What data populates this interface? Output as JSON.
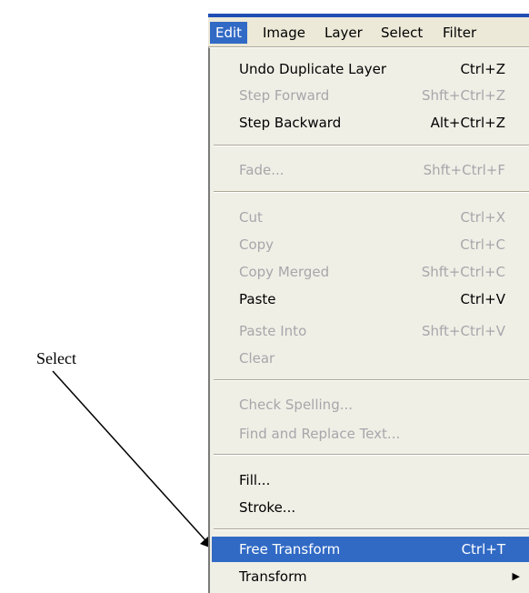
{
  "annotation": {
    "label": "Select"
  },
  "menubar": {
    "items": [
      {
        "label": "Edit",
        "active": true
      },
      {
        "label": "Image"
      },
      {
        "label": "Layer"
      },
      {
        "label": "Select"
      },
      {
        "label": "Filter"
      }
    ]
  },
  "menu": {
    "undo_duplicate_layer": {
      "label": "Undo Duplicate Layer",
      "shortcut": "Ctrl+Z"
    },
    "step_forward": {
      "label": "Step Forward",
      "shortcut": "Shft+Ctrl+Z"
    },
    "step_backward": {
      "label": "Step Backward",
      "shortcut": "Alt+Ctrl+Z"
    },
    "fade": {
      "label": "Fade...",
      "shortcut": "Shft+Ctrl+F"
    },
    "cut": {
      "label": "Cut",
      "shortcut": "Ctrl+X"
    },
    "copy": {
      "label": "Copy",
      "shortcut": "Ctrl+C"
    },
    "copy_merged": {
      "label": "Copy Merged",
      "shortcut": "Shft+Ctrl+C"
    },
    "paste": {
      "label": "Paste",
      "shortcut": "Ctrl+V"
    },
    "paste_into": {
      "label": "Paste Into",
      "shortcut": "Shft+Ctrl+V"
    },
    "clear": {
      "label": "Clear"
    },
    "check_spelling": {
      "label": "Check Spelling..."
    },
    "find_replace": {
      "label": "Find and Replace Text..."
    },
    "fill": {
      "label": "Fill..."
    },
    "stroke": {
      "label": "Stroke..."
    },
    "free_transform": {
      "label": "Free Transform",
      "shortcut": "Ctrl+T"
    },
    "transform": {
      "label": "Transform"
    }
  },
  "colors": {
    "highlight": "#316ac5",
    "disabled_text": "#a7a6aa",
    "menu_bg": "#f0efe6"
  },
  "icons": {
    "arrow": "annotation-arrow",
    "submenu": "submenu-arrow-icon"
  }
}
